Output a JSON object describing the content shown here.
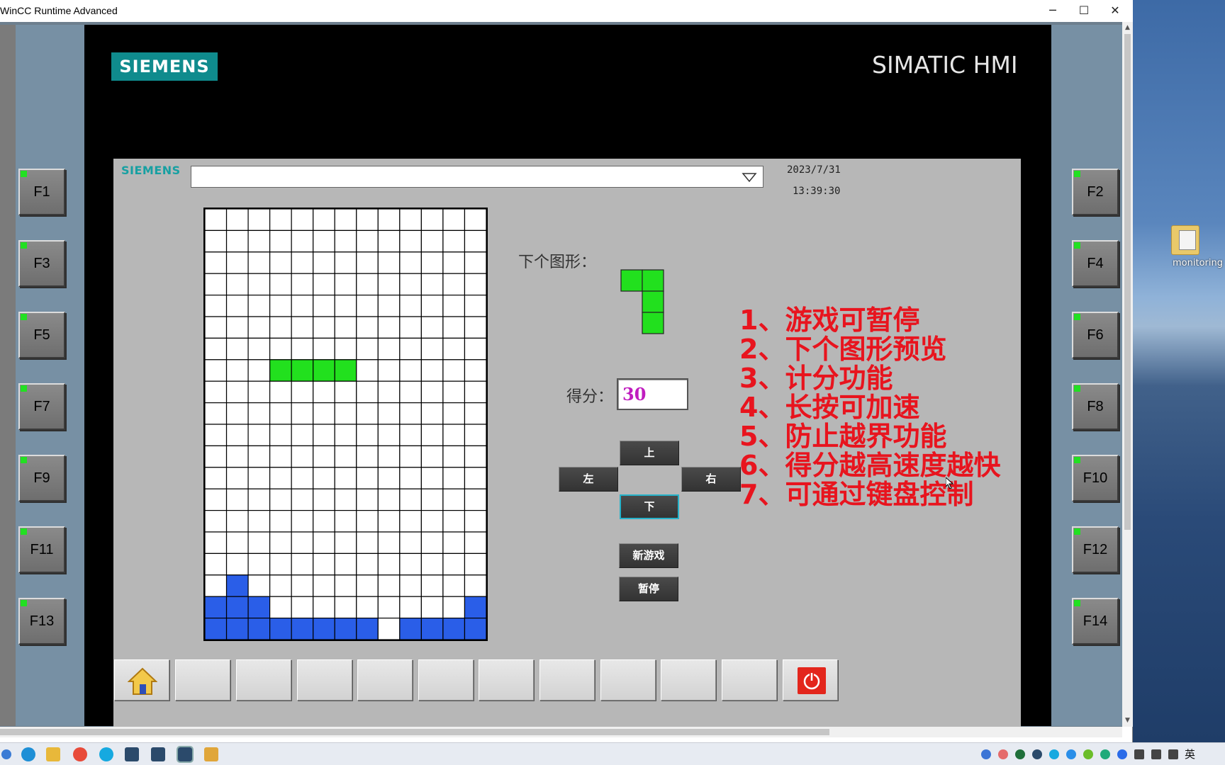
{
  "window": {
    "title": "WinCC Runtime Advanced",
    "minimize": "─",
    "maximize": "☐",
    "close": "✕"
  },
  "hmi": {
    "brand": "SIEMENS",
    "product": "SIMATIC HMI",
    "header_logo": "SIEMENS",
    "date": "2023/7/31",
    "time": "13:39:30"
  },
  "fkeys_left": [
    "F1",
    "F3",
    "F5",
    "F7",
    "F9",
    "F11",
    "F13"
  ],
  "fkeys_right": [
    "F2",
    "F4",
    "F6",
    "F8",
    "F10",
    "F12",
    "F14"
  ],
  "game": {
    "next_label": "下个图形：",
    "score_label": "得分：",
    "score": "30",
    "controls": {
      "up": "上",
      "left": "左",
      "right": "右",
      "down": "下",
      "new_game": "新游戏",
      "pause": "暂停"
    },
    "colors": {
      "empty": "#ffffff",
      "falling": "#22e01e",
      "settled": "#2a5ee8",
      "grid": "#000000"
    },
    "board": {
      "cols": 13,
      "rows": 20,
      "falling_cells": [
        [
          7,
          3
        ],
        [
          7,
          4
        ],
        [
          7,
          5
        ],
        [
          7,
          6
        ]
      ],
      "settled_cells": [
        [
          17,
          1
        ],
        [
          18,
          0
        ],
        [
          18,
          1
        ],
        [
          18,
          2
        ],
        [
          18,
          12
        ],
        [
          19,
          0
        ],
        [
          19,
          1
        ],
        [
          19,
          2
        ],
        [
          19,
          3
        ],
        [
          19,
          4
        ],
        [
          19,
          5
        ],
        [
          19,
          6
        ],
        [
          19,
          7
        ],
        [
          19,
          9
        ],
        [
          19,
          10
        ],
        [
          19,
          11
        ],
        [
          19,
          12
        ]
      ]
    },
    "next_piece": [
      [
        0,
        0
      ],
      [
        0,
        1
      ],
      [
        1,
        1
      ],
      [
        2,
        1
      ]
    ]
  },
  "features": [
    "1、游戏可暂停",
    "2、下个图形预览",
    "3、计分功能",
    "4、长按可加速",
    "5、防止越界功能",
    "6、得分越高速度越快",
    "7、可通过键盘控制"
  ],
  "toolbar": {
    "buttons": [
      "home",
      "",
      "",
      "",
      "",
      "",
      "",
      "",
      "",
      "",
      "",
      "power"
    ]
  },
  "desktop": {
    "icon_label": "monitoring"
  },
  "taskbar": {
    "lang": "英"
  }
}
